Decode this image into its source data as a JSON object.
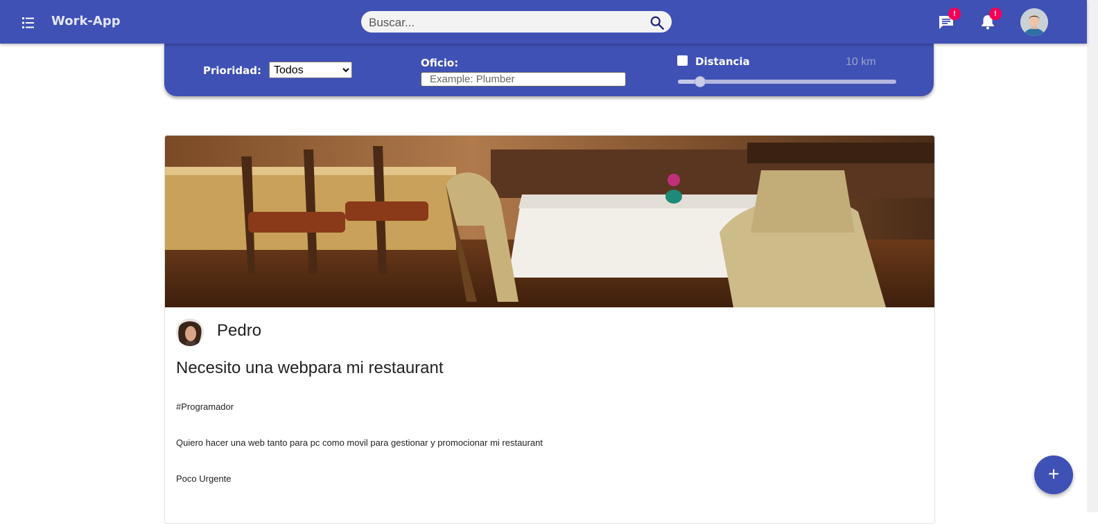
{
  "header": {
    "app_title": "Work-App",
    "search_placeholder": "Buscar...",
    "messages_badge": "!",
    "notifications_badge": "!"
  },
  "filters": {
    "priority_label": "Prioridad:",
    "priority_selected": "Todos",
    "trade_label": "Oficio:",
    "trade_placeholder": "Example: Plumber",
    "distance_label": "Distancia",
    "distance_checked": false,
    "distance_value": "10 km",
    "distance_slider_fraction": 0.1
  },
  "post": {
    "author": "Pedro",
    "title": "Necesito una webpara mi restaurant",
    "tag": "#Programador",
    "description": "Quiero hacer una web tanto para pc como movil para gestionar y promocionar mi restaurant",
    "priority": "Poco Urgente"
  },
  "fab": {
    "label": "+"
  },
  "colors": {
    "primary": "#3f51b5",
    "badge": "#f50057"
  }
}
